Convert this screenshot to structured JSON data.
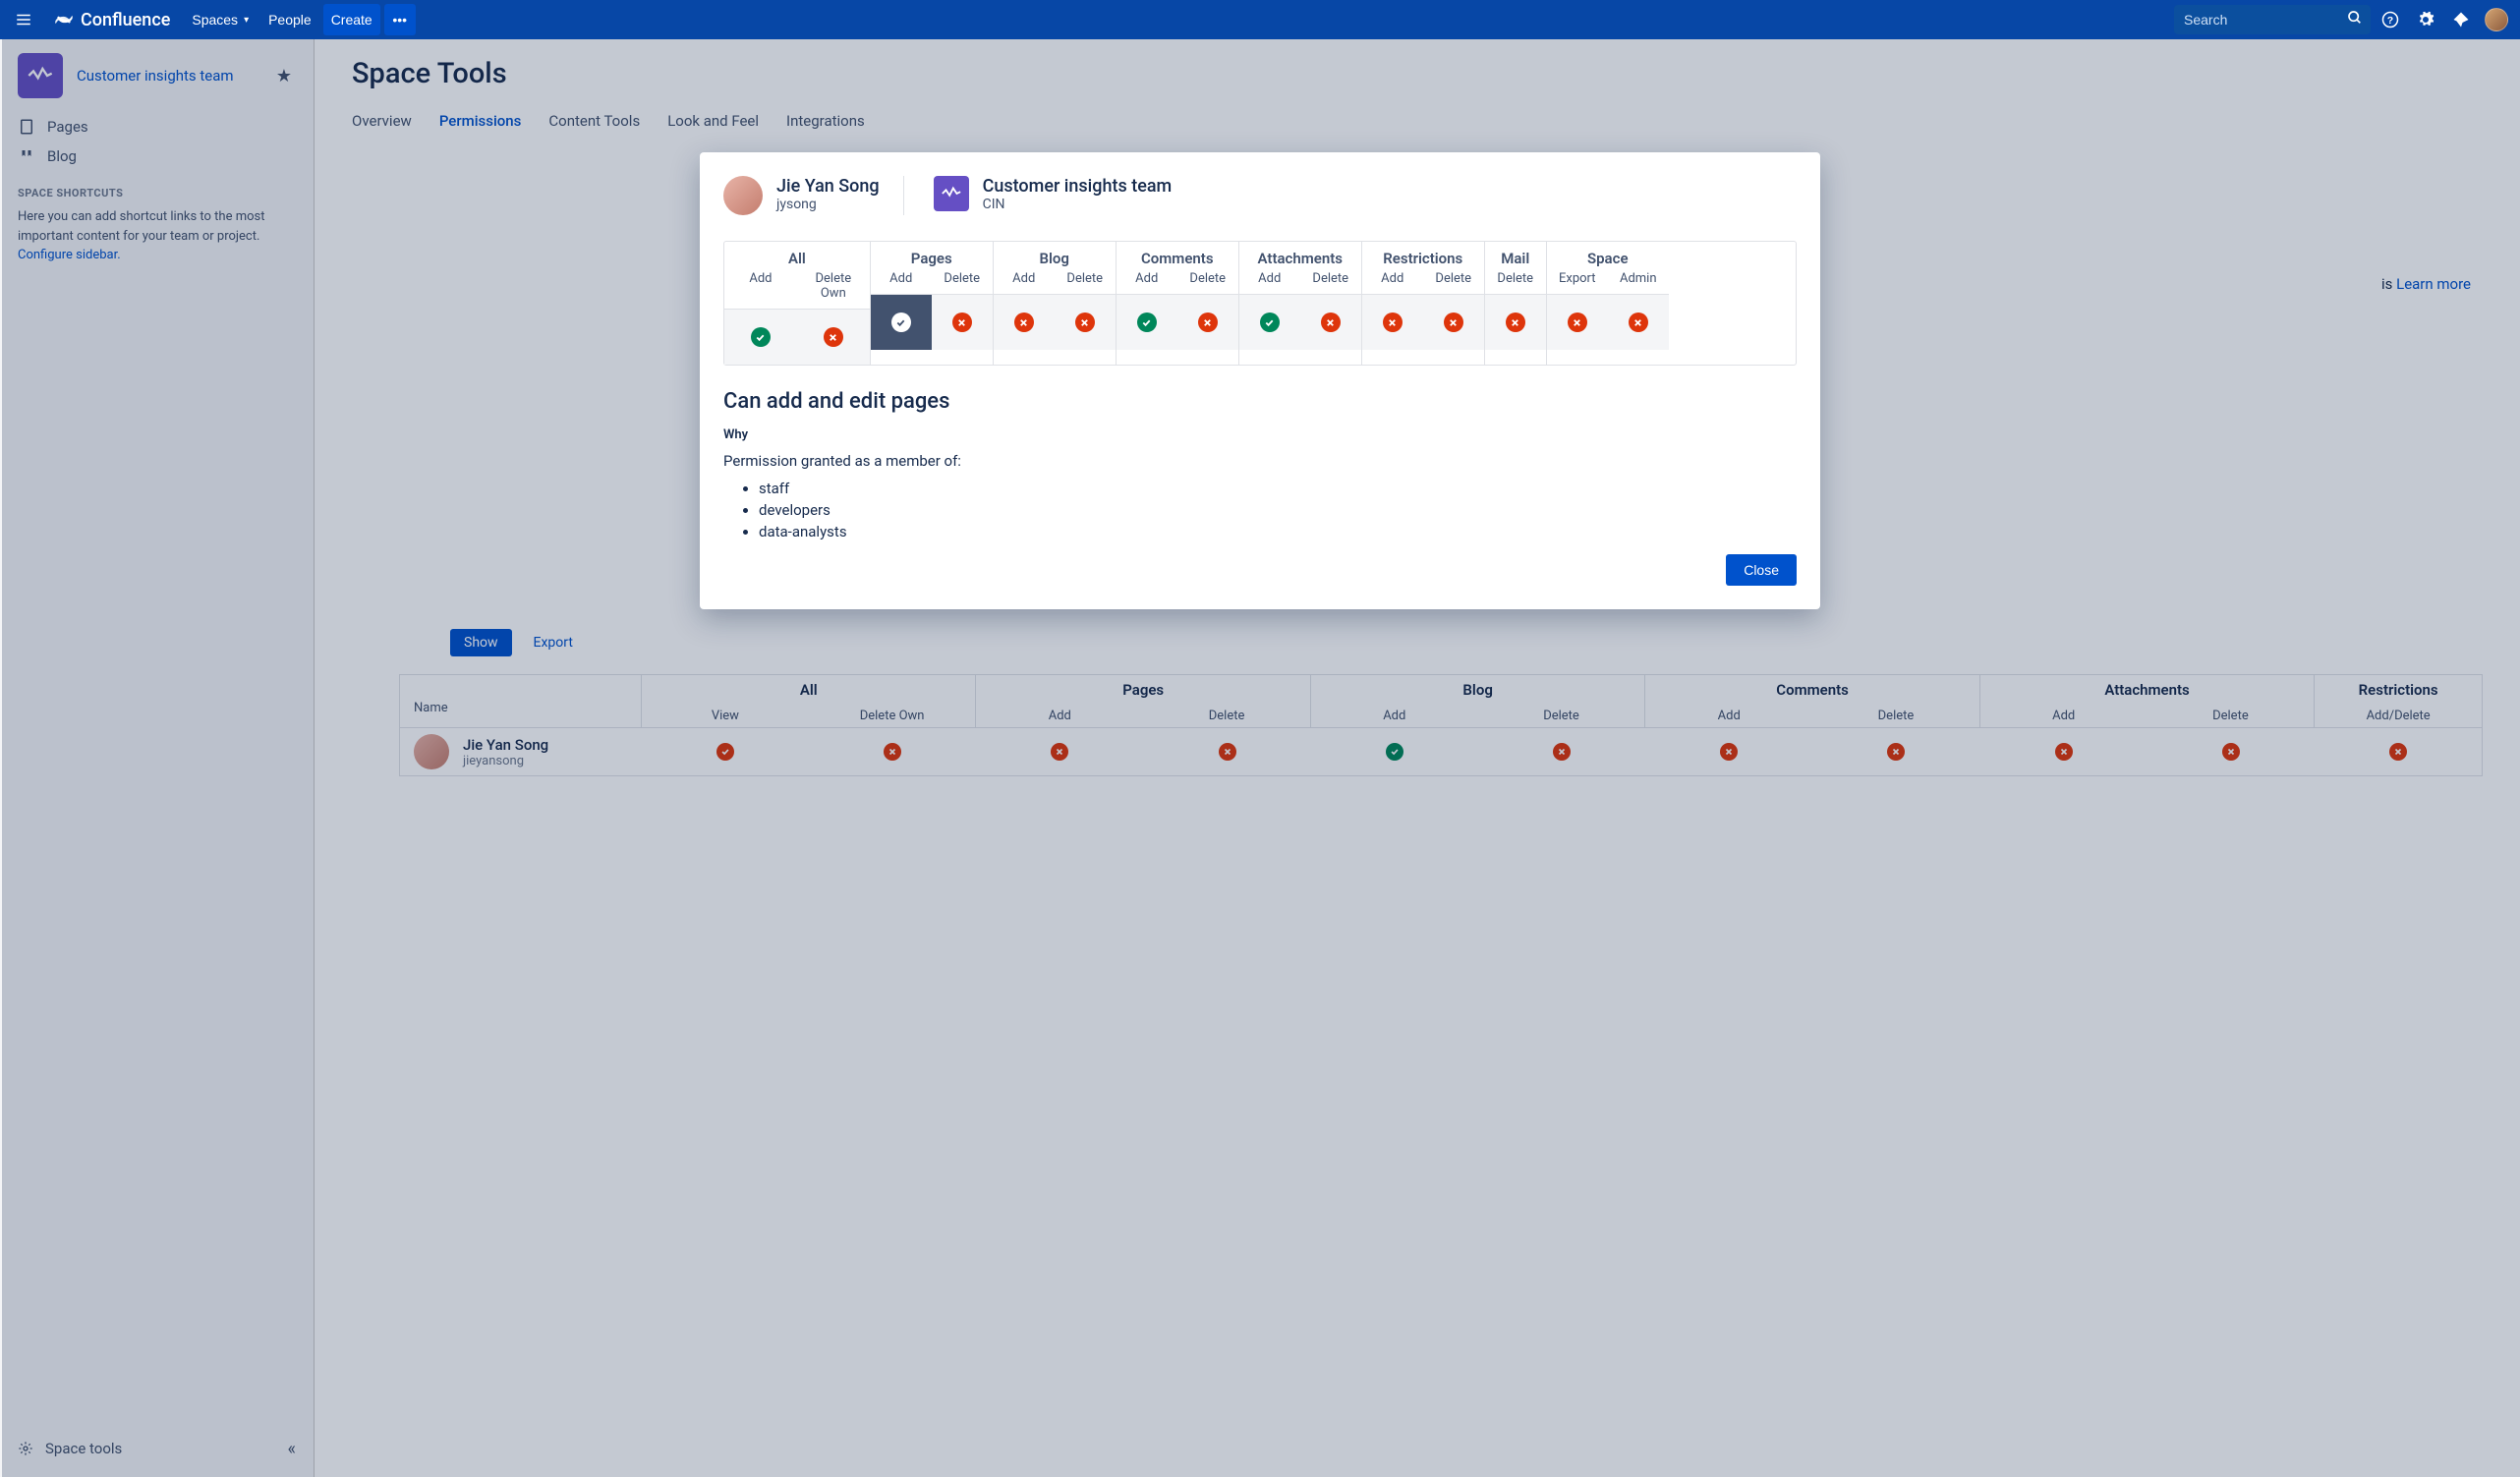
{
  "nav": {
    "brand": "Confluence",
    "spaces": "Spaces",
    "people": "People",
    "create": "Create",
    "search_placeholder": "Search"
  },
  "sidebar": {
    "space_name": "Customer insights team",
    "pages": "Pages",
    "blog": "Blog",
    "shortcuts_label": "SPACE SHORTCUTS",
    "shortcuts_text": "Here you can add shortcut links to the most important content for your team or project.",
    "configure_link": "Configure sidebar.",
    "space_tools": "Space tools"
  },
  "main": {
    "title": "Space Tools",
    "tabs": [
      "Overview",
      "Permissions",
      "Content Tools",
      "Look and Feel",
      "Integrations"
    ],
    "active_tab": "Permissions",
    "learn_more_prefix": "is",
    "learn_more": "Learn more",
    "subtabs": {
      "show": "Show",
      "export": "Export"
    }
  },
  "bg_table": {
    "groups": [
      {
        "label": "All",
        "subs": [
          "View",
          "Delete Own"
        ]
      },
      {
        "label": "Pages",
        "subs": [
          "Add",
          "Delete"
        ]
      },
      {
        "label": "Blog",
        "subs": [
          "Add",
          "Delete"
        ]
      },
      {
        "label": "Comments",
        "subs": [
          "Add",
          "Delete"
        ]
      },
      {
        "label": "Attachments",
        "subs": [
          "Add",
          "Delete"
        ]
      },
      {
        "label": "Restrictions",
        "subs": [
          "Add/Delete"
        ]
      }
    ],
    "name_header": "Name",
    "row": {
      "name": "Jie Yan Song",
      "username": "jieyansong",
      "perms": [
        "allow-r",
        "deny",
        "deny",
        "deny",
        "allow-g",
        "deny",
        "deny",
        "deny",
        "deny",
        "deny",
        "deny"
      ]
    }
  },
  "modal": {
    "user": {
      "name": "Jie Yan Song",
      "username": "jysong"
    },
    "space": {
      "name": "Customer insights team",
      "key": "CIN"
    },
    "groups": [
      {
        "label": "All",
        "subs": [
          "Add",
          "Delete Own"
        ],
        "vals": [
          "allow",
          "deny"
        ]
      },
      {
        "label": "Pages",
        "subs": [
          "Add",
          "Delete"
        ],
        "vals": [
          "allow-sel",
          "deny"
        ]
      },
      {
        "label": "Blog",
        "subs": [
          "Add",
          "Delete"
        ],
        "vals": [
          "deny",
          "deny"
        ]
      },
      {
        "label": "Comments",
        "subs": [
          "Add",
          "Delete"
        ],
        "vals": [
          "allow",
          "deny"
        ]
      },
      {
        "label": "Attachments",
        "subs": [
          "Add",
          "Delete"
        ],
        "vals": [
          "allow",
          "deny"
        ]
      },
      {
        "label": "Restrictions",
        "subs": [
          "Add",
          "Delete"
        ],
        "vals": [
          "deny",
          "deny"
        ]
      },
      {
        "label": "Mail",
        "subs": [
          "Delete"
        ],
        "vals": [
          "deny"
        ]
      },
      {
        "label": "Space",
        "subs": [
          "Export",
          "Admin"
        ],
        "vals": [
          "deny",
          "deny"
        ]
      }
    ],
    "detail_title": "Can add and edit pages",
    "why": "Why",
    "reason": "Permission granted as a member of:",
    "members": [
      "staff",
      "developers",
      "data-analysts"
    ],
    "close": "Close"
  }
}
